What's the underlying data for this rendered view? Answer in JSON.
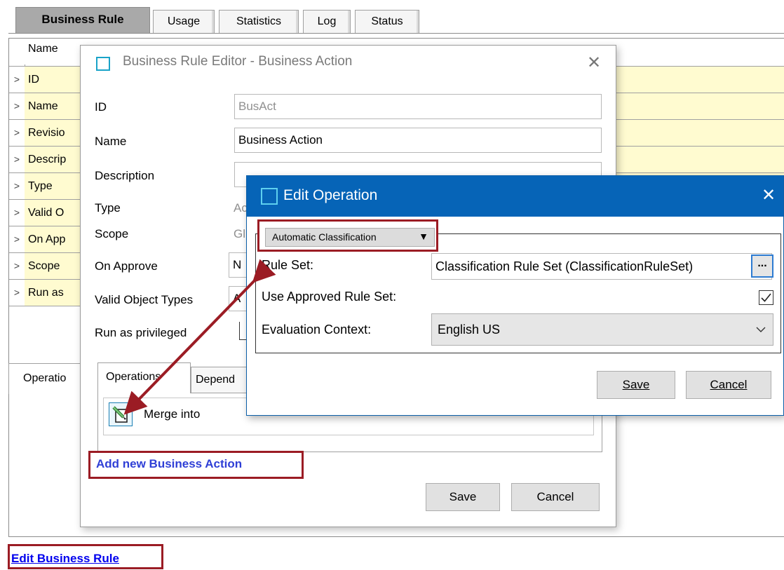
{
  "tabs": [
    {
      "label": "Business Rule",
      "active": true
    },
    {
      "label": "Usage",
      "active": false
    },
    {
      "label": "Statistics",
      "active": false
    },
    {
      "label": "Log",
      "active": false
    },
    {
      "label": "Status",
      "active": false
    }
  ],
  "grid": {
    "header": "Name",
    "rows": [
      "ID",
      "Name",
      "Revisio",
      "Descrip",
      "Type",
      "Valid O",
      "On App",
      "Scope",
      "Run as"
    ]
  },
  "bottom_tab_label": "Operatio",
  "edit_business_rule_link": "Edit Business Rule",
  "rule_editor": {
    "title": "Business Rule Editor - Business Action",
    "fields": {
      "id": {
        "label": "ID",
        "value": "BusAct"
      },
      "name": {
        "label": "Name",
        "value": "Business Action"
      },
      "description": {
        "label": "Description",
        "value": ""
      },
      "type": {
        "label": "Type",
        "value": "Ac"
      },
      "scope": {
        "label": "Scope",
        "value": "Gl"
      },
      "on_approve": {
        "label": "On Approve",
        "value": "N"
      },
      "valid_object_types": {
        "label": "Valid Object Types",
        "value": "A"
      },
      "run_as_privileged": {
        "label": "Run as privileged"
      }
    },
    "inner_tabs": [
      "Operations",
      "Depend"
    ],
    "operation_item": "Merge  into",
    "add_link": "Add new Business Action",
    "save": "Save",
    "cancel": "Cancel"
  },
  "edit_operation": {
    "title": "Edit Operation",
    "operation_type": "Automatic Classification",
    "rule_set_label": "Rule Set:",
    "rule_set_value": "Classification Rule Set (ClassificationRuleSet)",
    "browse": "...",
    "use_approved_label": "Use Approved Rule Set:",
    "use_approved_checked": true,
    "eval_context_label": "Evaluation Context:",
    "eval_context_value": "English US",
    "save": "Save",
    "cancel": "Cancel"
  },
  "colors": {
    "highlight": "#9b1c24",
    "titlebar": "#0664b7",
    "row_yellow": "#fffbd0",
    "link": "#0000ee"
  }
}
